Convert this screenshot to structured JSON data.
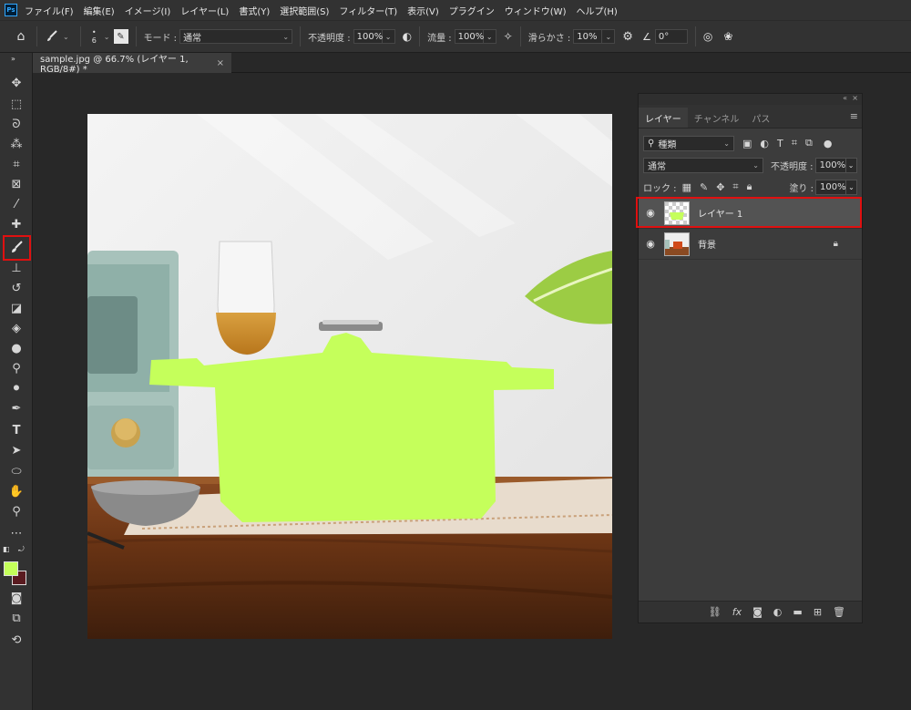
{
  "app": {
    "logo_text": "Ps",
    "menu": [
      "ファイル(F)",
      "編集(E)",
      "イメージ(I)",
      "レイヤー(L)",
      "書式(Y)",
      "選択範囲(S)",
      "フィルター(T)",
      "表示(V)",
      "プラグイン",
      "ウィンドウ(W)",
      "ヘルプ(H)"
    ]
  },
  "options_bar": {
    "brush_size": "6",
    "mode_label": "モード :",
    "mode_value": "通常",
    "opacity_label": "不透明度 :",
    "opacity_value": "100%",
    "flow_label": "流量 :",
    "flow_value": "100%",
    "smoothing_label": "滑らかさ :",
    "smoothing_value": "10%",
    "angle_value": "0°"
  },
  "document": {
    "tab_title": "sample.jpg @ 66.7% (レイヤー 1, RGB/8#) *",
    "close_glyph": "×"
  },
  "toolbar": {
    "foreground_color": "#c4ff5a",
    "background_color": "#5a1b20",
    "active_tool": "brush-tool"
  },
  "layers_panel": {
    "tabs": [
      "レイヤー",
      "チャンネル",
      "パス"
    ],
    "active_tab": "レイヤー",
    "filter_label": "種類",
    "blend_mode": "通常",
    "opacity_label": "不透明度 :",
    "opacity_value": "100%",
    "lock_label": "ロック :",
    "fill_label": "塗り :",
    "fill_value": "100%",
    "layers": [
      {
        "name": "レイヤー 1",
        "selected": true,
        "visible": true,
        "locked": false
      },
      {
        "name": "背景",
        "selected": false,
        "visible": true,
        "locked": true
      }
    ]
  }
}
